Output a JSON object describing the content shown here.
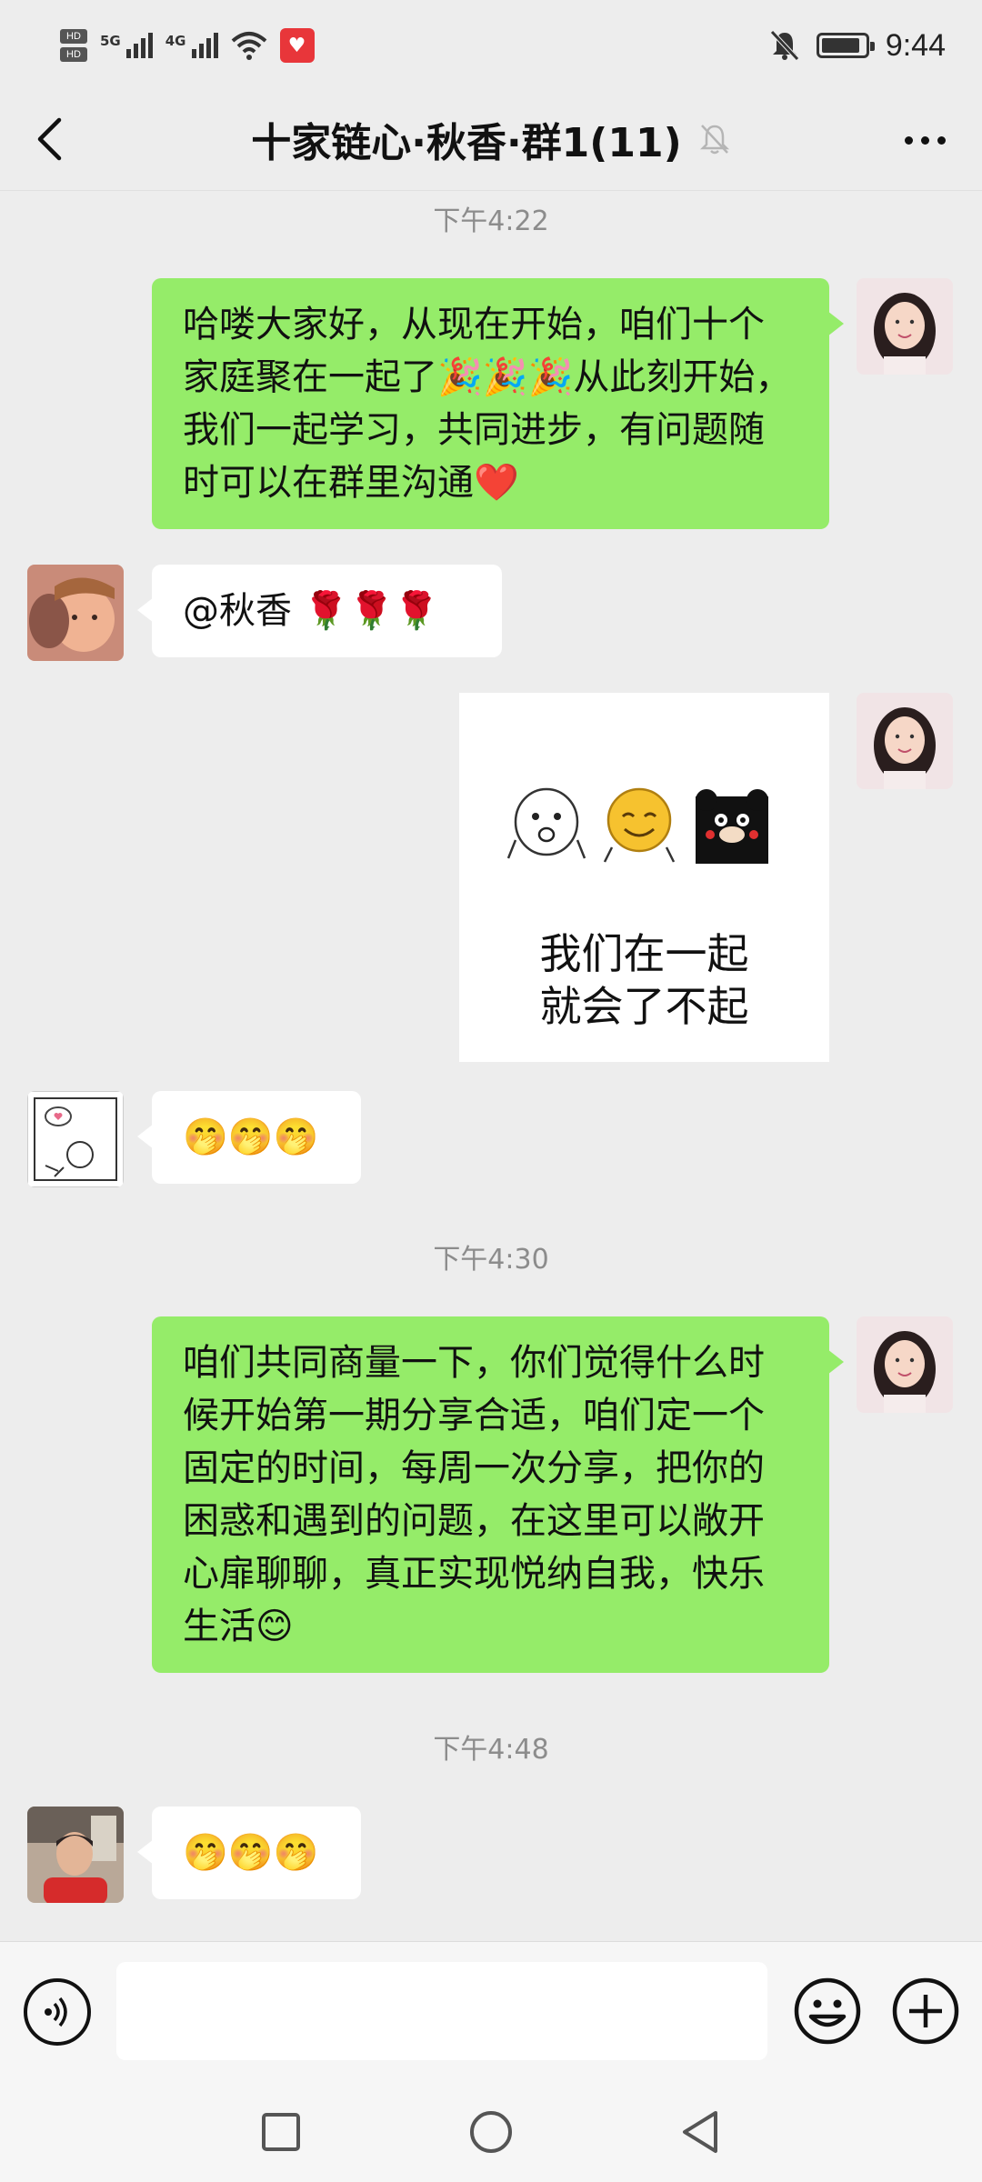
{
  "status_bar": {
    "hd_label": "HD",
    "network_1": "5G",
    "network_2": "4G",
    "app_badge_icon": "heart-icon",
    "time": "9:44",
    "battery_level": 0.9
  },
  "header": {
    "back_icon": "back-chevron-icon",
    "title": "十家链心·秋香·群1(11)",
    "mute_icon": "bell-muted-icon",
    "more_icon": "more-dots-icon"
  },
  "chat": {
    "timestamps": [
      "下午4:22",
      "下午4:30",
      "下午4:48"
    ],
    "messages": [
      {
        "sender": "self",
        "text": "哈喽大家好，从现在开始，咱们十个家庭聚在一起了🎉🎉🎉从此刻开始，我们一起学习，共同进步，有问题随时可以在群里沟通❤️"
      },
      {
        "sender": "other",
        "text": "@秋香 🌹🌹🌹"
      },
      {
        "sender": "self",
        "type": "sticker",
        "sticker_line1": "我们在一起",
        "sticker_line2": "就会了不起"
      },
      {
        "sender": "other",
        "text": "🤭🤭🤭"
      },
      {
        "sender": "self",
        "text": "咱们共同商量一下，你们觉得什么时候开始第一期分享合适，咱们定一个固定的时间，每周一次分享，把你的困惑和遇到的问题，在这里可以敞开心扉聊聊，真正实现悦纳自我，快乐生活😊"
      },
      {
        "sender": "other",
        "text": "🤭🤭🤭"
      }
    ]
  },
  "input_bar": {
    "voice_icon": "voice-icon",
    "input_value": "",
    "emoji_icon": "emoji-icon",
    "plus_icon": "plus-icon"
  },
  "nav_bar": {
    "recent_icon": "square-recents-icon",
    "home_icon": "circle-home-icon",
    "back_icon": "triangle-back-icon"
  },
  "colors": {
    "self_bubble": "#95ec69",
    "other_bubble": "#ffffff",
    "background": "#ededed"
  }
}
